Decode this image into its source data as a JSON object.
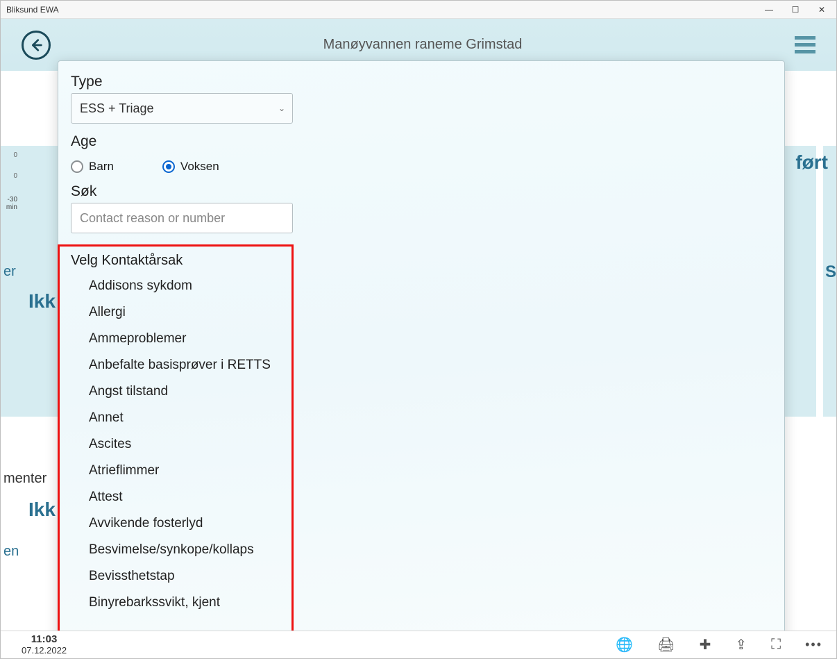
{
  "window": {
    "title": "Bliksund EWA"
  },
  "header": {
    "location": "Manøyvannen raneme Grimstad"
  },
  "behind": {
    "right_label": "ført",
    "right_label2": "S",
    "left_label1": "er",
    "left_label2": "menter",
    "left_label3": "Ikk",
    "left_label4": "Ikk",
    "left_label5": "en",
    "scale0a": "0",
    "scale0b": "0",
    "scale_axis": "-30 min"
  },
  "modal": {
    "type_label": "Type",
    "type_value": "ESS + Triage",
    "age_label": "Age",
    "option_child": "Barn",
    "option_adult": "Voksen",
    "search_label": "Søk",
    "search_placeholder": "Contact reason or number",
    "list_header": "Velg Kontaktårsak",
    "items": [
      "Addisons sykdom",
      "Allergi",
      "Ammeproblemer",
      "Anbefalte basisprøver i RETTS",
      "Angst tilstand",
      "Annet",
      "Ascites",
      "Atrieflimmer",
      "Attest",
      "Avvikende fosterlyd",
      "Besvimelse/synkope/kollaps",
      "Bevissthetstap",
      "Binyrebarkssvikt, kjent"
    ]
  },
  "status": {
    "time": "11:03",
    "date": "07.12.2022"
  }
}
